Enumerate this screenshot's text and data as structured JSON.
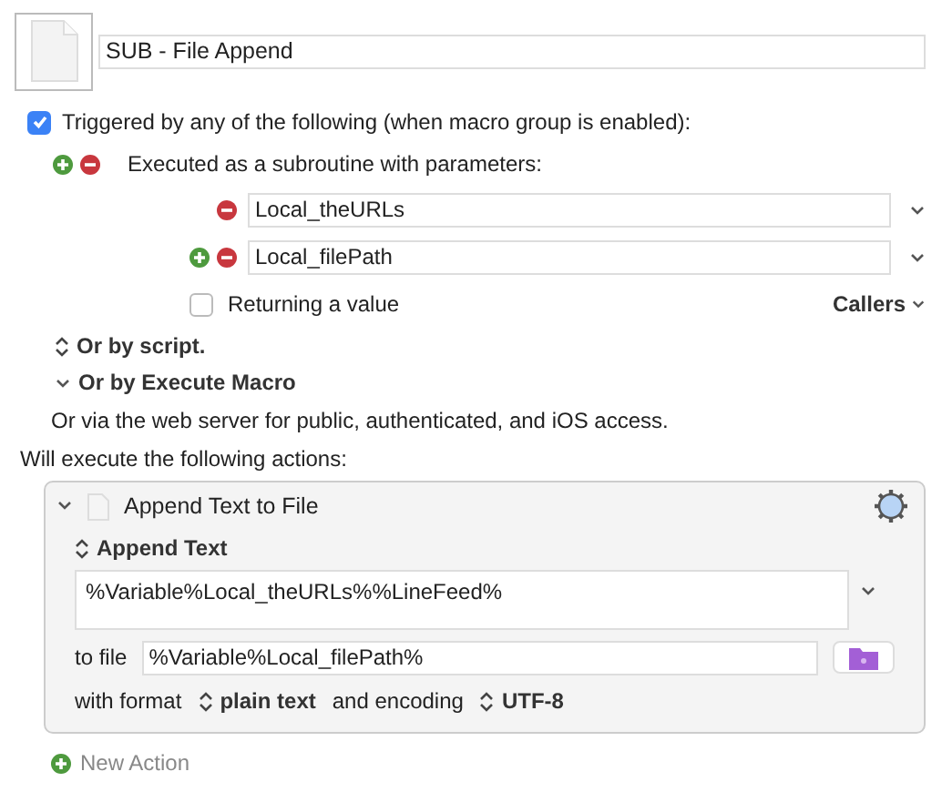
{
  "macro": {
    "name": "SUB - File Append"
  },
  "trigger": {
    "label": "Triggered by any of the following (when macro group is enabled):",
    "checked": true
  },
  "subroutine": {
    "label": "Executed as a subroutine with parameters:",
    "parameters": [
      {
        "value": "Local_theURLs",
        "add_button": false
      },
      {
        "value": "Local_filePath",
        "add_button": true
      }
    ],
    "returning": {
      "label": "Returning a value",
      "checked": false
    },
    "callers": "Callers"
  },
  "options": [
    {
      "label": "Or by script.",
      "kind": "popup"
    },
    {
      "label": "Or by Execute Macro",
      "kind": "disclosure"
    }
  ],
  "web_note": "Or via the web server for public, authenticated, and iOS access.",
  "actions_heading": "Will execute the following actions:",
  "action": {
    "title": "Append Text to File",
    "expanded": true,
    "section": "Append Text",
    "text": "%Variable%Local_theURLs%%LineFeed%",
    "file_label": "to file",
    "file_value": "%Variable%Local_filePath%",
    "format_label": "with format",
    "format": "plain text",
    "encoding_label": "and encoding",
    "encoding": "UTF-8"
  },
  "new_action": "New Action"
}
